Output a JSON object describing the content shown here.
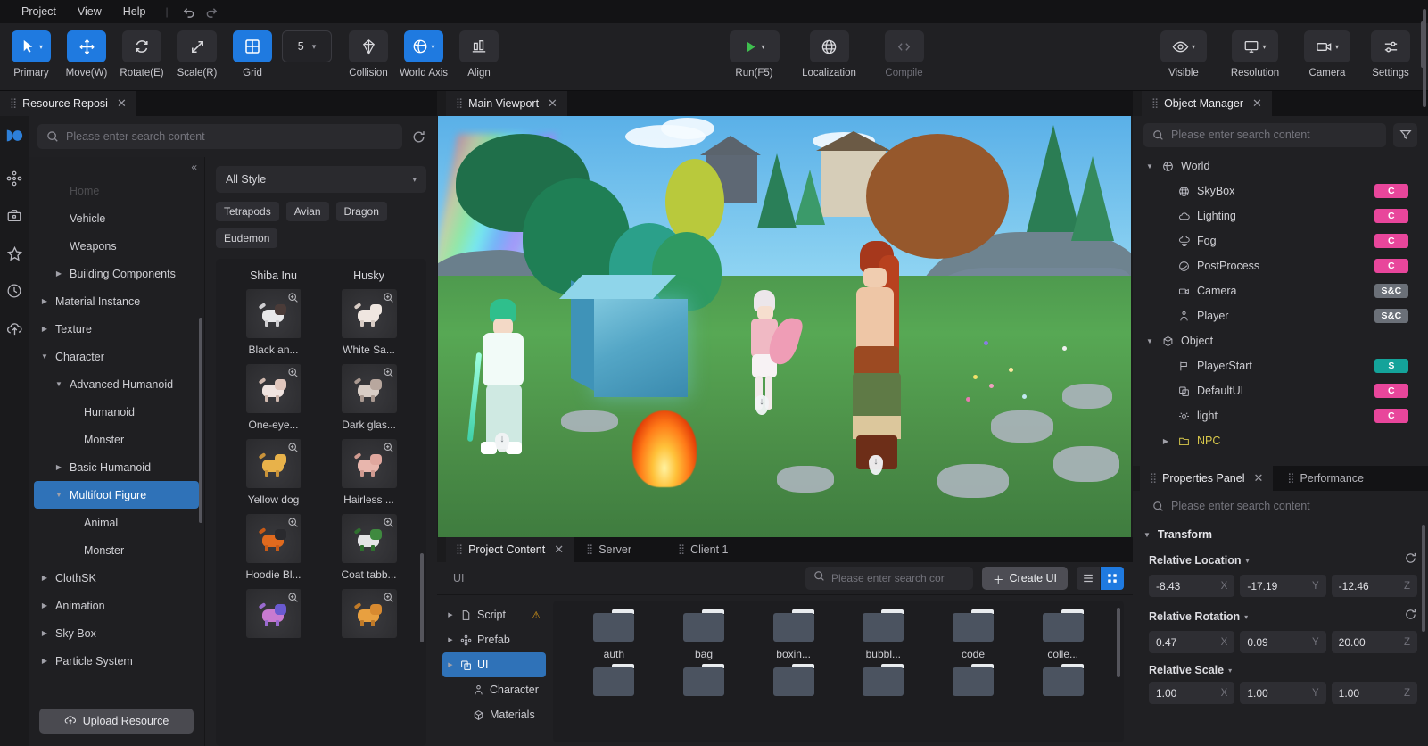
{
  "menubar": {
    "items": [
      "Project",
      "View",
      "Help"
    ],
    "separator": "|",
    "undo_icon": "undo-icon",
    "redo_icon": "redo-icon"
  },
  "toolbar": {
    "left_tools": [
      {
        "label": "Primary",
        "icon": "cursor-icon",
        "active": true,
        "has_chevron": true
      },
      {
        "label": "Move(W)",
        "icon": "move-icon",
        "active": true,
        "has_chevron": false
      },
      {
        "label": "Rotate(E)",
        "icon": "rotate-icon",
        "active": false,
        "has_chevron": false
      },
      {
        "label": "Scale(R)",
        "icon": "scale-icon",
        "active": false,
        "has_chevron": false
      },
      {
        "label": "Grid",
        "icon": "grid-icon",
        "active": true,
        "has_chevron": false
      }
    ],
    "grid_size_value": "5",
    "mid_tools": [
      {
        "label": "Collision",
        "icon": "collision-icon",
        "active": false,
        "has_chevron": false
      },
      {
        "label": "World Axis",
        "icon": "world-axis-icon",
        "active": true,
        "has_chevron": true
      },
      {
        "label": "Align",
        "icon": "align-icon",
        "active": false,
        "has_chevron": false
      }
    ],
    "center_tools": [
      {
        "label": "Run(F5)",
        "icon": "play-icon",
        "active": false,
        "has_chevron": true,
        "dim": false
      },
      {
        "label": "Localization",
        "icon": "globe-icon",
        "active": false,
        "has_chevron": false,
        "dim": false
      },
      {
        "label": "Compile",
        "icon": "code-icon",
        "active": false,
        "has_chevron": false,
        "dim": true
      }
    ],
    "right_tools": [
      {
        "label": "Visible",
        "icon": "eye-icon",
        "active": false,
        "has_chevron": true
      },
      {
        "label": "Resolution",
        "icon": "monitor-icon",
        "active": false,
        "has_chevron": true
      },
      {
        "label": "Camera",
        "icon": "camera-icon",
        "active": false,
        "has_chevron": true
      },
      {
        "label": "Settings",
        "icon": "sliders-icon",
        "active": false,
        "has_chevron": false
      }
    ]
  },
  "left_panel": {
    "tab_title": "Resource Reposi",
    "search_placeholder": "Please enter search content",
    "refresh_icon": "refresh-icon",
    "collapse_icon": "collapse-left-icon",
    "rail_icons": [
      "logo-icon",
      "prefab-nodes-icon",
      "toolbox-icon",
      "star-icon",
      "clock-icon",
      "cloud-upload-icon"
    ],
    "tree": [
      {
        "label": "Home",
        "indent": 1,
        "arrow": "none",
        "faded": true,
        "selected": false
      },
      {
        "label": "Vehicle",
        "indent": 1,
        "arrow": "none",
        "faded": false,
        "selected": false
      },
      {
        "label": "Weapons",
        "indent": 1,
        "arrow": "none",
        "faded": false,
        "selected": false
      },
      {
        "label": "Building Components",
        "indent": 1,
        "arrow": "right",
        "faded": false,
        "selected": false
      },
      {
        "label": "Material Instance",
        "indent": 0,
        "arrow": "right",
        "faded": false,
        "selected": false
      },
      {
        "label": "Texture",
        "indent": 0,
        "arrow": "right",
        "faded": false,
        "selected": false
      },
      {
        "label": "Character",
        "indent": 0,
        "arrow": "down",
        "faded": false,
        "selected": false
      },
      {
        "label": "Advanced Humanoid",
        "indent": 1,
        "arrow": "down",
        "faded": false,
        "selected": false
      },
      {
        "label": "Humanoid",
        "indent": 2,
        "arrow": "none",
        "faded": false,
        "selected": false
      },
      {
        "label": "Monster",
        "indent": 2,
        "arrow": "none",
        "faded": false,
        "selected": false
      },
      {
        "label": "Basic Humanoid",
        "indent": 1,
        "arrow": "right",
        "faded": false,
        "selected": false
      },
      {
        "label": "Multifoot Figure",
        "indent": 1,
        "arrow": "down",
        "faded": false,
        "selected": true
      },
      {
        "label": "Animal",
        "indent": 2,
        "arrow": "none",
        "faded": false,
        "selected": false
      },
      {
        "label": "Monster",
        "indent": 2,
        "arrow": "none",
        "faded": false,
        "selected": false
      },
      {
        "label": "ClothSK",
        "indent": 0,
        "arrow": "right",
        "faded": false,
        "selected": false
      },
      {
        "label": "Animation",
        "indent": 0,
        "arrow": "right",
        "faded": false,
        "selected": false
      },
      {
        "label": "Sky Box",
        "indent": 0,
        "arrow": "right",
        "faded": false,
        "selected": false
      },
      {
        "label": "Particle System",
        "indent": 0,
        "arrow": "right",
        "faded": false,
        "selected": false
      }
    ],
    "upload_button": "Upload Resource",
    "upload_icon": "cloud-upload-icon",
    "style_select_value": "All Style",
    "chips": [
      "Tetrapods",
      "Avian",
      "Dragon",
      "Eudemon"
    ],
    "asset_columns": [
      "Shiba Inu",
      "Husky"
    ],
    "assets": [
      {
        "name": "Black an...",
        "column": 0,
        "body": "#e8e8ea",
        "head": "#4a3b38",
        "accent": "#d0cfd2"
      },
      {
        "name": "White Sa...",
        "column": 1,
        "body": "#efe6e0",
        "head": "#efe6e0",
        "accent": "#d8ccc5"
      },
      {
        "name": "One-eye...",
        "column": 0,
        "body": "#f0e4e0",
        "head": "#e0c6bc",
        "accent": "#cfb8ae"
      },
      {
        "name": "Dark glas...",
        "column": 1,
        "body": "#d8cdc6",
        "head": "#b8a79e",
        "accent": "#a89890"
      },
      {
        "name": "Yellow dog",
        "column": 0,
        "body": "#e8b24a",
        "head": "#e8b24a",
        "accent": "#c9933a"
      },
      {
        "name": "Hairless ...",
        "column": 1,
        "body": "#e8b6ad",
        "head": "#e0a79e",
        "accent": "#d09a90"
      },
      {
        "name": "Hoodie Bl...",
        "column": 0,
        "body": "#e06a1e",
        "head": "#2a2a2e",
        "accent": "#c85a16"
      },
      {
        "name": "Coat tabb...",
        "column": 1,
        "body": "#e4e4e6",
        "head": "#3f8a3f",
        "accent": "#2f6f2f"
      },
      {
        "name": "",
        "column": 0,
        "body": "#c87ad0",
        "head": "#6a5ad0",
        "accent": "#9a6ad0"
      },
      {
        "name": "",
        "column": 1,
        "body": "#e8a040",
        "head": "#d88a30",
        "accent": "#c07a28"
      }
    ]
  },
  "viewport": {
    "tab_title": "Main Viewport"
  },
  "bottom_panel": {
    "tabs": [
      {
        "label": "Project Content",
        "active": true,
        "closable": true
      },
      {
        "label": "Server",
        "active": false,
        "closable": false
      },
      {
        "label": "Client 1",
        "active": false,
        "closable": false
      }
    ],
    "breadcrumb": "UI",
    "search_placeholder": "Please enter search cor",
    "create_button": "Create UI",
    "create_icon": "plus-icon",
    "view_list_icon": "list-view-icon",
    "view_grid_icon": "grid-view-icon",
    "tree": [
      {
        "label": "Script",
        "icon": "file-icon",
        "arrow": "right",
        "indent": 0,
        "selected": false,
        "warning": true
      },
      {
        "label": "Prefab",
        "icon": "prefab-icon",
        "arrow": "right",
        "indent": 0,
        "selected": false,
        "warning": false
      },
      {
        "label": "UI",
        "icon": "ui-icon",
        "arrow": "right",
        "indent": 0,
        "selected": true,
        "warning": false
      },
      {
        "label": "Character",
        "icon": "character-icon",
        "arrow": "none",
        "indent": 1,
        "selected": false,
        "warning": false
      },
      {
        "label": "Materials",
        "icon": "cube-icon",
        "arrow": "none",
        "indent": 1,
        "selected": false,
        "warning": false
      }
    ],
    "folders": [
      "auth",
      "bag",
      "boxin...",
      "bubbl...",
      "code",
      "colle..."
    ],
    "folders_row2_count": 6
  },
  "object_manager": {
    "tab_title": "Object Manager",
    "search_placeholder": "Please enter search content",
    "filter_icon": "filter-icon",
    "items": [
      {
        "label": "World",
        "icon": "world-icon",
        "arrow": "down",
        "indent": 0,
        "badge": "",
        "badge_color": ""
      },
      {
        "label": "SkyBox",
        "icon": "globe-icon",
        "arrow": "none",
        "indent": 1,
        "badge": "C",
        "badge_color": "#e8469b"
      },
      {
        "label": "Lighting",
        "icon": "cloud-icon",
        "arrow": "none",
        "indent": 1,
        "badge": "C",
        "badge_color": "#e8469b"
      },
      {
        "label": "Fog",
        "icon": "fog-icon",
        "arrow": "none",
        "indent": 1,
        "badge": "C",
        "badge_color": "#e8469b"
      },
      {
        "label": "PostProcess",
        "icon": "postprocess-icon",
        "arrow": "none",
        "indent": 1,
        "badge": "C",
        "badge_color": "#e8469b"
      },
      {
        "label": "Camera",
        "icon": "camera-icon",
        "arrow": "none",
        "indent": 1,
        "badge": "S&C",
        "badge_color": "#6b7078"
      },
      {
        "label": "Player",
        "icon": "player-icon",
        "arrow": "none",
        "indent": 1,
        "badge": "S&C",
        "badge_color": "#6b7078"
      },
      {
        "label": "Object",
        "icon": "cube-icon",
        "arrow": "down",
        "indent": 0,
        "badge": "",
        "badge_color": ""
      },
      {
        "label": "PlayerStart",
        "icon": "flag-icon",
        "arrow": "none",
        "indent": 1,
        "badge": "S",
        "badge_color": "#14a39a"
      },
      {
        "label": "DefaultUI",
        "icon": "ui-icon",
        "arrow": "none",
        "indent": 1,
        "badge": "C",
        "badge_color": "#e8469b"
      },
      {
        "label": "light",
        "icon": "light-icon",
        "arrow": "none",
        "indent": 1,
        "badge": "C",
        "badge_color": "#e8469b"
      },
      {
        "label": "NPC",
        "icon": "folder-icon",
        "arrow": "right",
        "indent": 1,
        "badge": "",
        "badge_color": "",
        "is_folder": true
      }
    ]
  },
  "properties_panel": {
    "tabs": [
      {
        "label": "Properties Panel",
        "active": true,
        "closable": true
      },
      {
        "label": "Performance",
        "active": false,
        "closable": false
      }
    ],
    "search_placeholder": "Please enter search content",
    "section_title": "Transform",
    "reset_icon": "reset-icon",
    "groups": [
      {
        "label": "Relative Location",
        "has_reset": true,
        "fields": [
          {
            "value": "-8.43",
            "axis": "X"
          },
          {
            "value": "-17.19",
            "axis": "Y"
          },
          {
            "value": "-12.46",
            "axis": "Z"
          }
        ]
      },
      {
        "label": "Relative Rotation",
        "has_reset": true,
        "fields": [
          {
            "value": "0.47",
            "axis": "X"
          },
          {
            "value": "0.09",
            "axis": "Y"
          },
          {
            "value": "20.00",
            "axis": "Z"
          }
        ]
      },
      {
        "label": "Relative Scale",
        "has_reset": false,
        "fields": [
          {
            "value": "1.00",
            "axis": "X"
          },
          {
            "value": "1.00",
            "axis": "Y"
          },
          {
            "value": "1.00",
            "axis": "Z"
          }
        ]
      }
    ]
  },
  "colors": {
    "accent_blue": "#1f7ae0",
    "select_blue": "#2f72b8",
    "badge_pink": "#e8469b",
    "badge_teal": "#14a39a",
    "badge_gray": "#6b7078",
    "warn_amber": "#e8a317",
    "run_green": "#3fbf4f",
    "folder_yellow": "#d8c84b",
    "panel_bg": "#202023",
    "app_bg": "#1b1b1d"
  }
}
